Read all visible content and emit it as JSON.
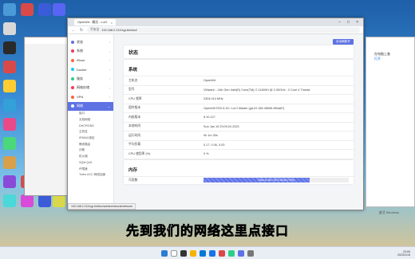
{
  "browser": {
    "tab_title": "OpenWrt - 概况 - LuCI",
    "url_security": "不安全",
    "url": "192.168.2.212/cgi-bin/luci/",
    "status_url": "192.168.2.212/cgi-bin/luci/admin/network/network"
  },
  "sidebar": {
    "items": [
      {
        "label": "状态",
        "color": "#5e72e4"
      },
      {
        "label": "系统",
        "color": "#f5365c"
      },
      {
        "label": "iStore",
        "color": "#fb6340"
      },
      {
        "label": "Docker",
        "color": "#11cdef"
      },
      {
        "label": "服务",
        "color": "#2dce89"
      },
      {
        "label": "网络存储",
        "color": "#f5365c"
      },
      {
        "label": "VPN",
        "color": "#fb6340"
      },
      {
        "label": "网络",
        "color": "#ffffff",
        "active": true
      }
    ],
    "subitems": [
      "接口",
      "无线网络",
      "DHCP/DNS",
      "主机名",
      "IP/MAC绑定",
      "静态路由",
      "诊断",
      "防火墙",
      "SQM QoS",
      "IP限速",
      "Turbo ACC 网络加速"
    ]
  },
  "main": {
    "logout": "自动刷新开",
    "page_title": "状态",
    "system_title": "系统",
    "rows": [
      {
        "k": "主机名",
        "v": "OpenWrt"
      },
      {
        "k": "型号",
        "v": "VMware - 11th Gen Intel(R) Core(TM) i7-11800H @ 2.30GHz : 2 Core 4 Thread"
      },
      {
        "k": "CPU 频率",
        "v": "2304.014 MHz"
      },
      {
        "k": "固件版本",
        "v": "OpenWrt R22.6.16 / LuCI Master (git-22.186.45696-f6f4a87)"
      },
      {
        "k": "内核版本",
        "v": "5.10.127"
      },
      {
        "k": "本地时间",
        "v": "Sun Jan 15 23:09:24 2023"
      },
      {
        "k": "运行时间",
        "v": "0h 1m 30s"
      },
      {
        "k": "平均负载",
        "v": "0.17, 0.06, 0.03"
      },
      {
        "k": "CPU 使用率 (%)",
        "v": "0 %"
      }
    ],
    "memory_title": "内存",
    "memory_label": "可用数",
    "memory_bar_text": "1444.41 kB / 1971.08 kB (73%)",
    "memory_fraction": 0.73
  },
  "right_window": {
    "line1": "在电脑上查",
    "line2": "打开"
  },
  "activate_windows": "激活 Windows",
  "subtitle": "先到我们的网络这里点接口",
  "tray": {
    "time": "23:09",
    "date": "2023/1/15"
  }
}
